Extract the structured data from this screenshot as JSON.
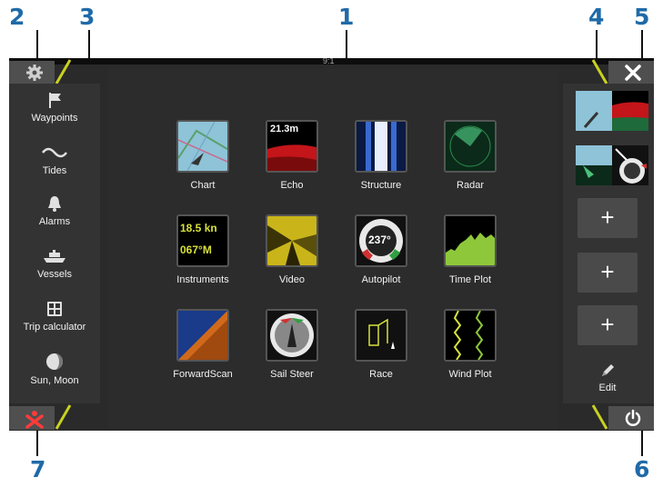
{
  "callouts": {
    "c1": "1",
    "c2": "2",
    "c3": "3",
    "c4": "4",
    "c5": "5",
    "c6": "6",
    "c7": "7"
  },
  "status": {
    "clock": "9:1"
  },
  "sidebar": {
    "items": [
      {
        "label": "Waypoints",
        "icon": "flag-icon"
      },
      {
        "label": "Tides",
        "icon": "wave-icon"
      },
      {
        "label": "Alarms",
        "icon": "bell-icon"
      },
      {
        "label": "Vessels",
        "icon": "vessels-icon"
      },
      {
        "label": "Trip calculator",
        "icon": "calculator-icon"
      },
      {
        "label": "Sun, Moon",
        "icon": "sun-moon-icon"
      }
    ]
  },
  "apps": {
    "items": [
      {
        "label": "Chart"
      },
      {
        "label": "Echo",
        "tile_text": "21.3m"
      },
      {
        "label": "Structure"
      },
      {
        "label": "Radar"
      },
      {
        "label": "Instruments",
        "tile_text_1": "18.5 kn",
        "tile_text_2": "067°M"
      },
      {
        "label": "Video"
      },
      {
        "label": "Autopilot",
        "tile_text": "237°"
      },
      {
        "label": "Time Plot"
      },
      {
        "label": "ForwardScan"
      },
      {
        "label": "Sail Steer"
      },
      {
        "label": "Race"
      },
      {
        "label": "Wind Plot"
      }
    ]
  },
  "rightbar": {
    "add_label": "+",
    "edit_label": "Edit"
  },
  "colors": {
    "accent": "#c9d11f",
    "callout": "#1f6aa8",
    "close_icon": "#ff3b3b"
  }
}
